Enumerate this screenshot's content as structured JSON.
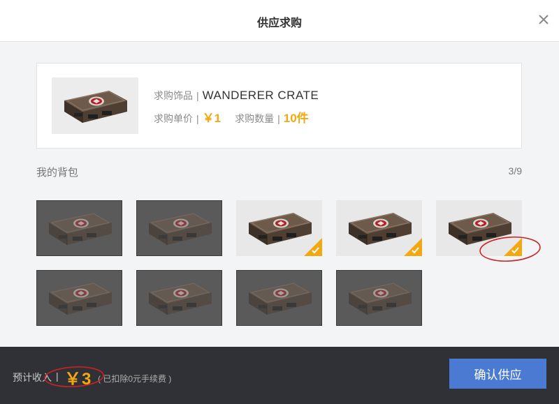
{
  "dialog": {
    "title": "供应求购"
  },
  "purchase": {
    "item_label": "求购饰品",
    "item_name": "WANDERER CRATE",
    "unit_price_label": "求购单价",
    "unit_price": "￥1",
    "quantity_label": "求购数量",
    "quantity": "10件",
    "separator": "|",
    "item_icon": "crate-image"
  },
  "bag": {
    "title": "我的背包",
    "count": "3/9",
    "slots": [
      {
        "state": "unselected"
      },
      {
        "state": "unselected"
      },
      {
        "state": "selected"
      },
      {
        "state": "selected"
      },
      {
        "state": "selected"
      },
      {
        "state": "unselected"
      },
      {
        "state": "unselected"
      },
      {
        "state": "unselected"
      },
      {
        "state": "unselected"
      }
    ]
  },
  "footer": {
    "income_label": "预计收入",
    "separator": "|",
    "income_value": "￥3",
    "fee_note": "( 已扣除0元手续费 )",
    "confirm_label": "确认供应"
  },
  "colors": {
    "accent": "#f2a811",
    "confirm_button": "#4a7ad1",
    "footer_bg": "#2f3136",
    "annotation": "#cc2222"
  }
}
